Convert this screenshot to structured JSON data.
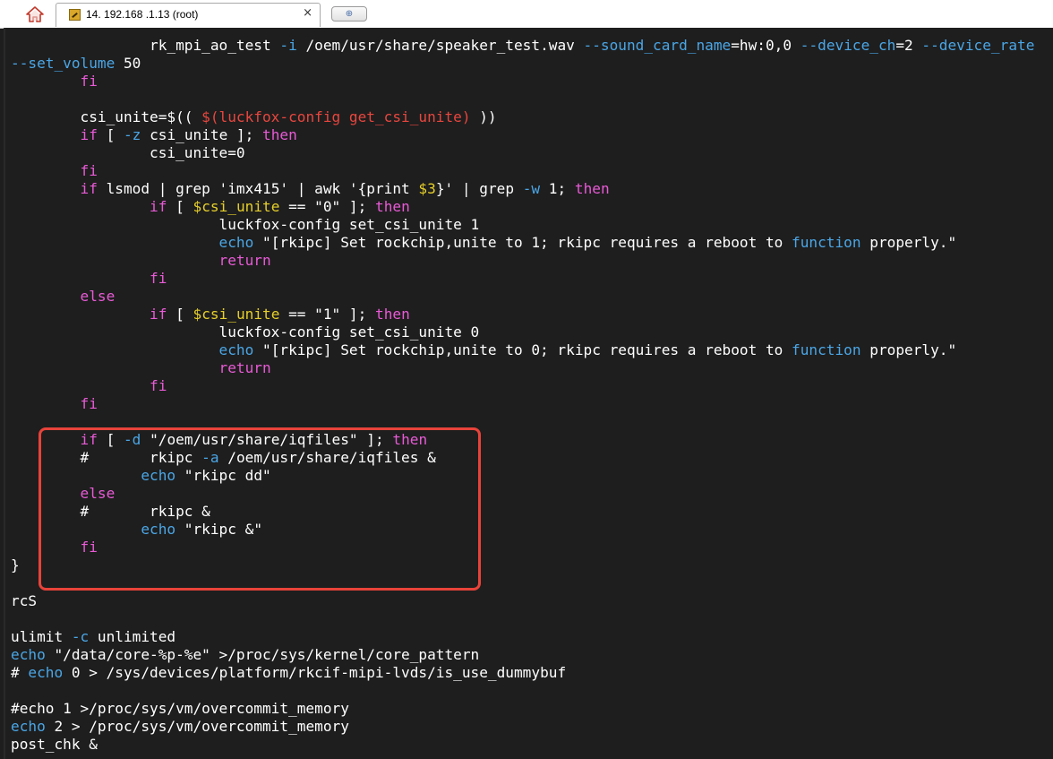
{
  "tabbar": {
    "home_icon": "home-icon",
    "tab_title": "14. 192.168 .1.13 (root)",
    "tab_icon": "terminal-session-icon",
    "close_label": "×",
    "new_tab_icon": "new-tab-icon",
    "new_tab_label": "⊕"
  },
  "colors": {
    "background": "#1e1e1e",
    "text": "#ffffff",
    "option": "#4aa6e6",
    "keyword": "#e85ad6",
    "substitution": "#e8463e",
    "variable": "#e6cf2a",
    "highlight_box": "#e8433a"
  },
  "terminal": {
    "lines": [
      [
        [
          "text",
          "                rk_mpi_ao_test "
        ],
        [
          "opt",
          "-i"
        ],
        [
          "text",
          " /oem/usr/share/speaker_test.wav "
        ],
        [
          "opt",
          "--sound_card_name"
        ],
        [
          "text",
          "=hw:0,0 "
        ],
        [
          "opt",
          "--device_ch"
        ],
        [
          "text",
          "=2 "
        ],
        [
          "opt",
          "--device_rate"
        ]
      ],
      [
        [
          "opt",
          "--set_volume"
        ],
        [
          "text",
          " 50"
        ]
      ],
      [
        [
          "text",
          "        "
        ],
        [
          "kw",
          "fi"
        ]
      ],
      [
        [
          "text",
          ""
        ]
      ],
      [
        [
          "text",
          "        csi_unite=$(( "
        ],
        [
          "sub",
          "$(luckfox-config get_csi_unite)"
        ],
        [
          "text",
          " ))"
        ]
      ],
      [
        [
          "text",
          "        "
        ],
        [
          "kw",
          "if"
        ],
        [
          "text",
          " [ "
        ],
        [
          "opt",
          "-z"
        ],
        [
          "text",
          " csi_unite ]; "
        ],
        [
          "kw",
          "then"
        ]
      ],
      [
        [
          "text",
          "                csi_unite=0"
        ]
      ],
      [
        [
          "text",
          "        "
        ],
        [
          "kw",
          "fi"
        ]
      ],
      [
        [
          "text",
          "        "
        ],
        [
          "kw",
          "if"
        ],
        [
          "text",
          " lsmod | grep 'imx415' | awk '{print "
        ],
        [
          "var",
          "$3"
        ],
        [
          "text",
          "}' | grep "
        ],
        [
          "opt",
          "-w"
        ],
        [
          "text",
          " 1; "
        ],
        [
          "kw",
          "then"
        ]
      ],
      [
        [
          "text",
          "                "
        ],
        [
          "kw",
          "if"
        ],
        [
          "text",
          " [ "
        ],
        [
          "var",
          "$csi_unite"
        ],
        [
          "text",
          " == \"0\" ]; "
        ],
        [
          "kw",
          "then"
        ]
      ],
      [
        [
          "text",
          "                        luckfox-config set_csi_unite 1"
        ]
      ],
      [
        [
          "text",
          "                        "
        ],
        [
          "opt",
          "echo"
        ],
        [
          "text",
          " \"[rkipc] Set rockchip,unite to 1; rkipc requires a reboot to "
        ],
        [
          "opt",
          "function"
        ],
        [
          "text",
          " properly.\""
        ]
      ],
      [
        [
          "text",
          "                        "
        ],
        [
          "kw",
          "return"
        ]
      ],
      [
        [
          "text",
          "                "
        ],
        [
          "kw",
          "fi"
        ]
      ],
      [
        [
          "text",
          "        "
        ],
        [
          "kw",
          "else"
        ]
      ],
      [
        [
          "text",
          "                "
        ],
        [
          "kw",
          "if"
        ],
        [
          "text",
          " [ "
        ],
        [
          "var",
          "$csi_unite"
        ],
        [
          "text",
          " == \"1\" ]; "
        ],
        [
          "kw",
          "then"
        ]
      ],
      [
        [
          "text",
          "                        luckfox-config set_csi_unite 0"
        ]
      ],
      [
        [
          "text",
          "                        "
        ],
        [
          "opt",
          "echo"
        ],
        [
          "text",
          " \"[rkipc] Set rockchip,unite to 0; rkipc requires a reboot to "
        ],
        [
          "opt",
          "function"
        ],
        [
          "text",
          " properly.\""
        ]
      ],
      [
        [
          "text",
          "                        "
        ],
        [
          "kw",
          "return"
        ]
      ],
      [
        [
          "text",
          "                "
        ],
        [
          "kw",
          "fi"
        ]
      ],
      [
        [
          "text",
          "        "
        ],
        [
          "kw",
          "fi"
        ]
      ],
      [
        [
          "text",
          ""
        ]
      ],
      [
        [
          "text",
          "        "
        ],
        [
          "kw",
          "if"
        ],
        [
          "text",
          " [ "
        ],
        [
          "opt",
          "-d"
        ],
        [
          "text",
          " \"/oem/usr/share/iqfiles\" ]; "
        ],
        [
          "kw",
          "then"
        ]
      ],
      [
        [
          "text",
          "        #       rkipc "
        ],
        [
          "opt",
          "-a"
        ],
        [
          "text",
          " /oem/usr/share/iqfiles &"
        ]
      ],
      [
        [
          "text",
          "               "
        ],
        [
          "opt",
          "echo"
        ],
        [
          "text",
          " \"rkipc dd\""
        ]
      ],
      [
        [
          "text",
          "        "
        ],
        [
          "kw",
          "else"
        ]
      ],
      [
        [
          "text",
          "        #       rkipc &"
        ]
      ],
      [
        [
          "text",
          "               "
        ],
        [
          "opt",
          "echo"
        ],
        [
          "text",
          " \"rkipc &\""
        ]
      ],
      [
        [
          "text",
          "        "
        ],
        [
          "kw",
          "fi"
        ]
      ],
      [
        [
          "text",
          "}"
        ]
      ],
      [
        [
          "text",
          ""
        ]
      ],
      [
        [
          "text",
          "rcS"
        ]
      ],
      [
        [
          "text",
          ""
        ]
      ],
      [
        [
          "text",
          "ulimit "
        ],
        [
          "opt",
          "-c"
        ],
        [
          "text",
          " unlimited"
        ]
      ],
      [
        [
          "opt",
          "echo"
        ],
        [
          "text",
          " \"/data/core-%p-%e\" >/proc/sys/kernel/core_pattern"
        ]
      ],
      [
        [
          "text",
          "# "
        ],
        [
          "opt",
          "echo"
        ],
        [
          "text",
          " 0 > /sys/devices/platform/rkcif-mipi-lvds/is_use_dummybuf"
        ]
      ],
      [
        [
          "text",
          ""
        ]
      ],
      [
        [
          "text",
          "#echo 1 >/proc/sys/vm/overcommit_memory"
        ]
      ],
      [
        [
          "opt",
          "echo"
        ],
        [
          "text",
          " 2 > /proc/sys/vm/overcommit_memory"
        ]
      ],
      [
        [
          "text",
          "post_chk &"
        ]
      ]
    ]
  }
}
